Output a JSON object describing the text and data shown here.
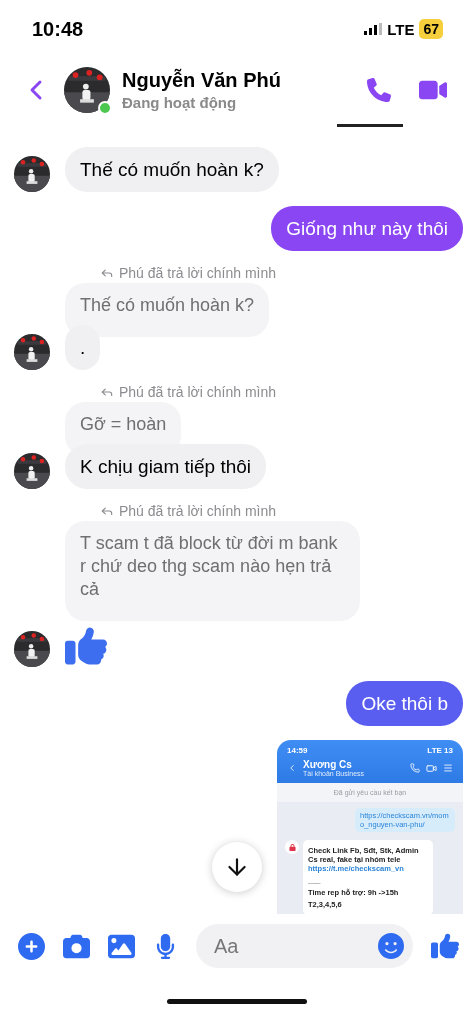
{
  "status_bar": {
    "time": "10:48",
    "network": "LTE",
    "battery": "67"
  },
  "header": {
    "name": "Nguyễn Văn Phú",
    "status": "Đang hoạt động",
    "online": true
  },
  "messages": [
    {
      "kind": "incoming",
      "text": "Thế có muốn hoàn k?"
    },
    {
      "kind": "outgoing",
      "text": "Giống như này thôi",
      "color": "#8a46f2"
    },
    {
      "kind": "reply",
      "note": "Phú đã trả lời chính mình",
      "quoted": "Thế có muốn hoàn k?",
      "text": "."
    },
    {
      "kind": "reply",
      "note": "Phú đã trả lời chính mình",
      "quoted": "Gỡ = hoàn",
      "text": "K chịu giam tiếp thôi"
    },
    {
      "kind": "reply_like",
      "note": "Phú đã trả lời chính mình",
      "quoted": "T scam t đã block từ đời m bank r chứ deo thg scam nào hẹn trả cả"
    },
    {
      "kind": "outgoing",
      "text": "Oke thôi b",
      "color": "#5a5ef0"
    },
    {
      "kind": "screenshot",
      "shot": {
        "time": "14:59",
        "network": "LTE",
        "battery": "13",
        "name": "Xương Cs",
        "subtitle": "Tài khoản Business",
        "banner": "Đã gửi yêu cầu kết bạn",
        "sent_link": "https://checkscam.vn/momo_nguyen-van-phu/",
        "received": "Check Link Fb, Sđt, Stk, Admin Cs real, fake tại nhóm tele ",
        "received_link": "https://t.me/checkscam_vn",
        "lines": [
          "___",
          "Time rep hỗ trợ: 9h ->15h",
          "T2,3,4,5,6"
        ]
      }
    }
  ],
  "composer": {
    "placeholder": "Aa"
  }
}
